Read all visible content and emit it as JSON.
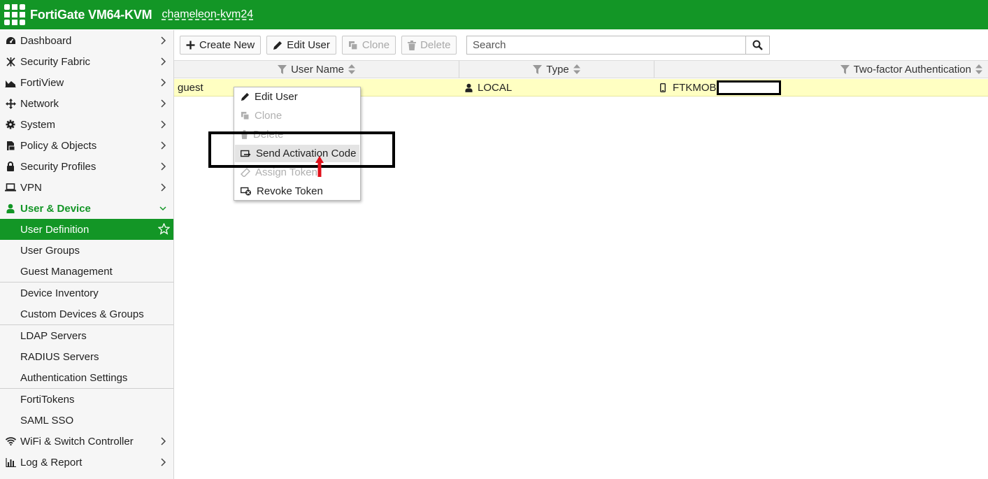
{
  "header": {
    "product": "FortiGate VM64-KVM",
    "hostname": "chameleon-kvm24"
  },
  "sidebar": {
    "top_items": [
      {
        "label": "Dashboard",
        "icon": "dashboard-icon"
      },
      {
        "label": "Security Fabric",
        "icon": "security-fabric-icon"
      },
      {
        "label": "FortiView",
        "icon": "fortiview-icon"
      },
      {
        "label": "Network",
        "icon": "network-icon"
      },
      {
        "label": "System",
        "icon": "gear-icon"
      },
      {
        "label": "Policy & Objects",
        "icon": "policy-icon"
      },
      {
        "label": "Security Profiles",
        "icon": "lock-icon"
      },
      {
        "label": "VPN",
        "icon": "laptop-icon"
      }
    ],
    "active_section": {
      "label": "User & Device",
      "icon": "user-icon"
    },
    "sub_items": [
      {
        "label": "User Definition"
      },
      {
        "label": "User Groups"
      },
      {
        "label": "Guest Management"
      },
      {
        "label": "Device Inventory"
      },
      {
        "label": "Custom Devices & Groups"
      },
      {
        "label": "LDAP Servers"
      },
      {
        "label": "RADIUS Servers"
      },
      {
        "label": "Authentication Settings"
      },
      {
        "label": "FortiTokens"
      },
      {
        "label": "SAML SSO"
      }
    ],
    "bottom_items": [
      {
        "label": "WiFi & Switch Controller",
        "icon": "wifi-icon"
      },
      {
        "label": "Log & Report",
        "icon": "chart-icon"
      }
    ]
  },
  "toolbar": {
    "create_new": "Create New",
    "edit_user": "Edit User",
    "clone": "Clone",
    "delete": "Delete",
    "search_placeholder": "Search"
  },
  "table": {
    "columns": [
      "User Name",
      "Type",
      "Two-factor Authentication"
    ],
    "rows": [
      {
        "user_name": "guest",
        "type": "LOCAL",
        "two_factor": "FTKMOB"
      }
    ]
  },
  "context_menu": {
    "items": [
      {
        "label": "Edit User",
        "enabled": true
      },
      {
        "label": "Clone",
        "enabled": false
      },
      {
        "label": "Delete",
        "enabled": false
      },
      {
        "label": "Send Activation Code",
        "enabled": true
      },
      {
        "label": "Assign Token",
        "enabled": false
      },
      {
        "label": "Revoke Token",
        "enabled": true
      }
    ]
  },
  "colors": {
    "brand_green": "#139626",
    "row_highlight": "#ffffc2"
  }
}
